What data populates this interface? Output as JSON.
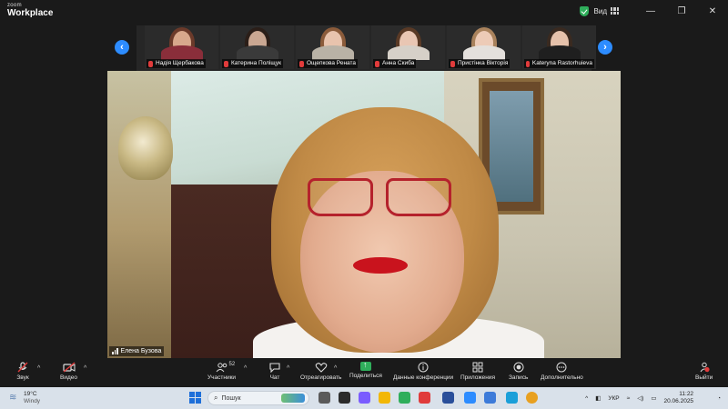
{
  "window": {
    "brand_small": "zoom",
    "brand_big": "Workplace",
    "view_label": "Вид",
    "minimize": "—",
    "maximize": "❐",
    "close": "✕"
  },
  "gallery": {
    "prev": "‹",
    "next": "›",
    "participants": [
      {
        "name": "Надія Щербакова",
        "skin": "#d8a88c",
        "hair": "#6b3a2a",
        "shirt": "#8a2e3a"
      },
      {
        "name": "Катерина Поліщук",
        "skin": "#caa792",
        "hair": "#2b1e18",
        "shirt": "#3a3a3a"
      },
      {
        "name": "Ощепкова Рената",
        "skin": "#e8c3ad",
        "hair": "#8b5b3a",
        "shirt": "#b9b2a6"
      },
      {
        "name": "Анна Скиба",
        "skin": "#e9c6b3",
        "hair": "#5a3a26",
        "shirt": "#d6d0c8"
      },
      {
        "name": "Пристінка Вікторія",
        "skin": "#edcbb7",
        "hair": "#a9825c",
        "shirt": "#e4e0dc"
      },
      {
        "name": "Kateryna Rastorhuieva",
        "skin": "#e6c2ab",
        "hair": "#3a2a20",
        "shirt": "#1f1f1f"
      }
    ]
  },
  "main_video": {
    "speaker_name": "Елена Бузова"
  },
  "toolbar": {
    "audio": "Звук",
    "video": "Видео",
    "participants": "Участники",
    "participants_count": "52",
    "chat": "Чат",
    "react": "Отреагировать",
    "share": "Поделиться",
    "info": "Данные конференции",
    "apps": "Приложения",
    "record": "Запись",
    "more": "Дополнительно",
    "leave": "Выйти",
    "caret": "^"
  },
  "taskbar": {
    "temp": "19°C",
    "weather": "Windy",
    "search": "Пошук",
    "lang": "УКР",
    "time": "11:22",
    "date": "20.06.2025"
  }
}
